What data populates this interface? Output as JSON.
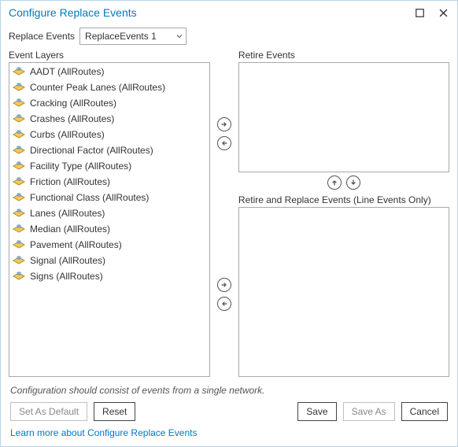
{
  "title": "Configure Replace Events",
  "toolbar": {
    "label": "Replace Events",
    "selected": "ReplaceEvents 1"
  },
  "panels": {
    "eventLayersLabel": "Event Layers",
    "retireEventsLabel": "Retire Events",
    "retireReplaceLabel": "Retire and Replace Events (Line Events Only)"
  },
  "eventLayers": [
    "AADT (AllRoutes)",
    "Counter Peak Lanes (AllRoutes)",
    "Cracking (AllRoutes)",
    "Crashes (AllRoutes)",
    "Curbs (AllRoutes)",
    "Directional Factor (AllRoutes)",
    "Facility Type (AllRoutes)",
    "Friction (AllRoutes)",
    "Functional Class (AllRoutes)",
    "Lanes (AllRoutes)",
    "Median (AllRoutes)",
    "Pavement (AllRoutes)",
    "Signal (AllRoutes)",
    "Signs (AllRoutes)"
  ],
  "note": "Configuration should consist of events from a single network.",
  "buttons": {
    "setAsDefault": "Set As Default",
    "reset": "Reset",
    "save": "Save",
    "saveAs": "Save As",
    "cancel": "Cancel"
  },
  "helpLink": "Learn more about Configure Replace Events",
  "icons": {
    "layer": "layer-icon",
    "moveRight": "arrow-right-icon",
    "moveLeft": "arrow-left-icon",
    "moveUp": "arrow-up-icon",
    "moveDown": "arrow-down-icon"
  }
}
